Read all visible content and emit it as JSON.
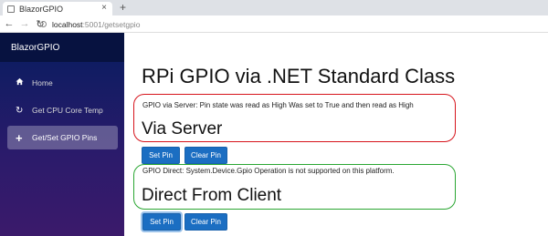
{
  "browser": {
    "tab_title": "BlazorGPIO",
    "tab_close": "×",
    "new_tab": "+",
    "url_host": "localhost",
    "url_rest": ":5001/getsetgpio"
  },
  "sidebar": {
    "brand": "BlazorGPIO",
    "items": [
      {
        "label": "Home",
        "icon": "home-icon"
      },
      {
        "label": "Get CPU Core Temp",
        "icon": "refresh-icon"
      },
      {
        "label": "Get/Set GPIO Pins",
        "icon": "plus-icon"
      }
    ]
  },
  "main": {
    "title": "RPi GPIO via .NET Standard Class",
    "server": {
      "status": "GPIO via Server: Pin state was read as High Was set to True and then read as High",
      "heading": "Via Server",
      "set_label": "Set Pin",
      "clear_label": "Clear Pin"
    },
    "client": {
      "status": "GPIO Direct: System.Device.Gpio Operation is not supported on this platform.",
      "heading": "Direct From Client",
      "set_label": "Set Pin",
      "clear_label": "Clear Pin"
    }
  },
  "colors": {
    "server_box_border": "#d6141c",
    "client_box_border": "#2aa632",
    "button": "#1b6ec2"
  }
}
